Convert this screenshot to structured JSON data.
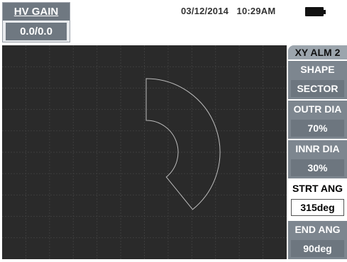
{
  "hv_gain": {
    "title": "HV GAIN",
    "value": "0.0/0.0"
  },
  "status": {
    "date": "03/12/2014",
    "time": "10:29AM",
    "battery_icon": "battery-icon"
  },
  "plot": {
    "background": "#2a2a2a",
    "grid_color": "#3d3d3d",
    "shape_color": "#bdbdbd",
    "shape": {
      "outer_dia_pct": 70,
      "inner_dia_pct": 30,
      "start_deg": 315,
      "end_deg": 90
    }
  },
  "menu": {
    "header": "XY ALM 2",
    "items": [
      {
        "label": "SHAPE",
        "value": "SECTOR"
      },
      {
        "label": "OUTR DIA",
        "value": "70%"
      },
      {
        "label": "INNR DIA",
        "value": "30%"
      },
      {
        "label": "STRT ANG",
        "value": "315deg"
      },
      {
        "label": "END ANG",
        "value": "90deg"
      }
    ]
  }
}
